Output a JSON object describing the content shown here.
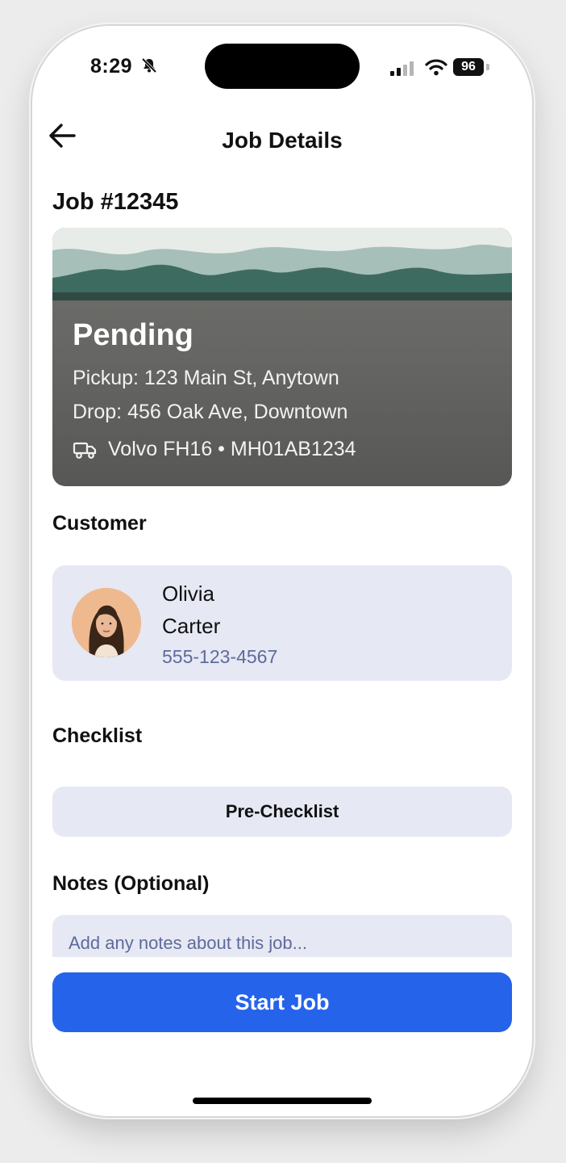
{
  "status_bar": {
    "time": "8:29",
    "battery": "96"
  },
  "header": {
    "title": "Job Details"
  },
  "job": {
    "number": "Job #12345",
    "status": "Pending",
    "pickup": "Pickup: 123 Main St, Anytown",
    "drop": "Drop: 456 Oak Ave, Downtown",
    "vehicle": "Volvo FH16 • MH01AB1234"
  },
  "customer": {
    "label": "Customer",
    "first_name": "Olivia",
    "last_name": "Carter",
    "phone": "555-123-4567"
  },
  "checklist": {
    "label": "Checklist",
    "button": "Pre-Checklist"
  },
  "notes": {
    "label": "Notes (Optional)",
    "placeholder": "Add any notes about this job...",
    "value": ""
  },
  "actions": {
    "start": "Start Job"
  },
  "colors": {
    "primary": "#2563eb",
    "card_bg": "#e6e8f3",
    "link": "#5d6b9c"
  }
}
